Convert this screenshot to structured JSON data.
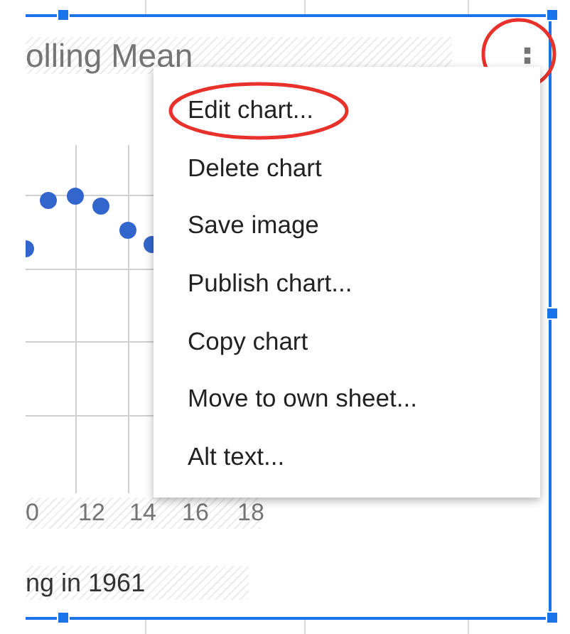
{
  "chart": {
    "title": "olling Mean",
    "x_labels": [
      "0",
      "12",
      "14",
      "16",
      "18"
    ],
    "subtitle": "ng in 1961"
  },
  "menu_button": {
    "label": "⋮",
    "highlighted": true
  },
  "menu": {
    "items": [
      {
        "label": "Edit chart...",
        "highlighted": true
      },
      {
        "label": "Delete chart",
        "highlighted": false
      },
      {
        "label": "Save image",
        "highlighted": false
      },
      {
        "label": "Publish chart...",
        "highlighted": false
      },
      {
        "label": "Copy chart",
        "highlighted": false
      },
      {
        "label": "Move to own sheet...",
        "highlighted": false
      },
      {
        "label": "Alt text...",
        "highlighted": false
      }
    ]
  }
}
